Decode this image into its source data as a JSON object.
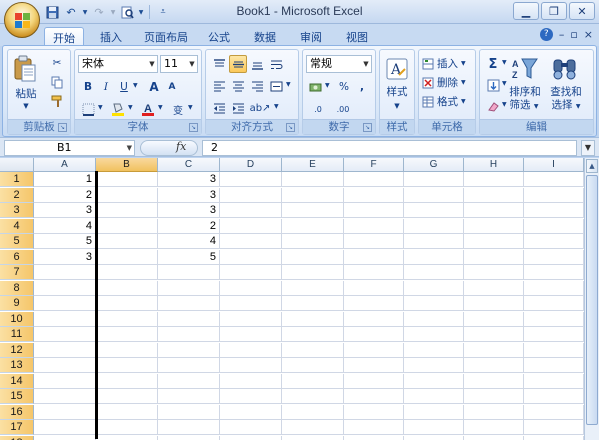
{
  "window": {
    "title": "Book1 - Microsoft Excel",
    "controls": [
      "minimize",
      "restore",
      "close"
    ]
  },
  "quick_access": [
    {
      "name": "save-icon",
      "glyph": "💾"
    },
    {
      "name": "undo-icon",
      "glyph": "↶"
    },
    {
      "name": "redo-icon",
      "glyph": "↷"
    },
    {
      "name": "print-preview-icon",
      "glyph": "🔍"
    }
  ],
  "tabs": [
    "开始",
    "插入",
    "页面布局",
    "公式",
    "数据",
    "审阅",
    "视图"
  ],
  "active_tab": "开始",
  "ribbon": {
    "clipboard": {
      "label": "剪贴板",
      "paste": "粘贴"
    },
    "font": {
      "label": "字体",
      "font_name": "宋体",
      "font_size": "11",
      "bold": "B",
      "italic": "I",
      "underline": "U",
      "grow": "A",
      "shrink": "A",
      "phonetic": "变"
    },
    "alignment": {
      "label": "对齐方式"
    },
    "number": {
      "label": "数字",
      "format": "常规",
      "percent": "%",
      "comma": ",",
      "increase_decimal": ".0",
      "decrease_decimal": ".00"
    },
    "styles": {
      "label": "样式"
    },
    "cells": {
      "label": "单元格",
      "insert": "插入",
      "delete": "删除",
      "format": "格式"
    },
    "editing": {
      "label": "编辑",
      "sum": "Σ",
      "sort_filter_1": "排序和",
      "sort_filter_2": "筛选",
      "find_select_1": "查找和",
      "find_select_2": "选择"
    }
  },
  "formula_bar": {
    "name_box": "B1",
    "fx": "fx",
    "value": "2"
  },
  "columns": [
    "A",
    "B",
    "C",
    "D",
    "E",
    "F",
    "G",
    "H",
    "I",
    "J"
  ],
  "rows": [
    "1",
    "2",
    "3",
    "4",
    "5",
    "6",
    "7",
    "8",
    "9",
    "10",
    "11",
    "12",
    "13",
    "14",
    "15",
    "16",
    "17",
    "18"
  ],
  "cells": {
    "A": [
      "1",
      "2",
      "3",
      "4",
      "5",
      "3"
    ],
    "C": [
      "3",
      "3",
      "3",
      "2",
      "4",
      "5"
    ]
  },
  "selected_cell": "B1",
  "colors": {
    "accent": "#15428b",
    "header_highlight": "#f5c66a",
    "ribbon_bg": "#dfeafa"
  }
}
